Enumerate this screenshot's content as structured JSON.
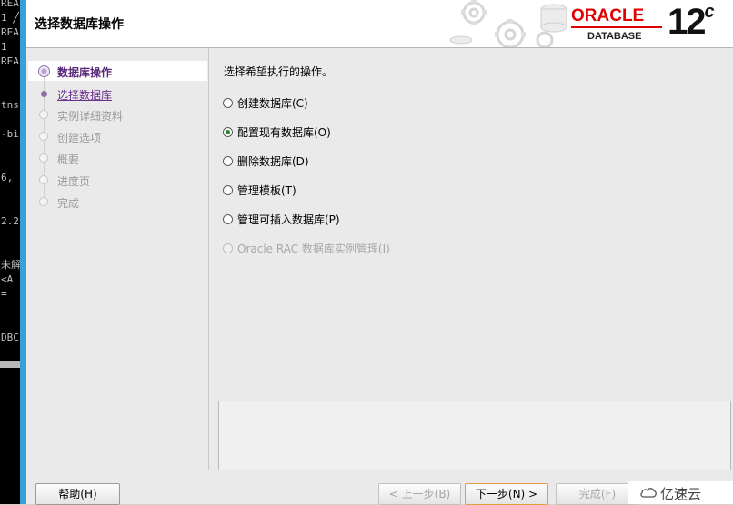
{
  "terminal": {
    "lines": [
      "REA",
      "1 ╱",
      "REA",
      "  1",
      "REA",
      "tns",
      "-bi",
      "6,",
      "2.2",
      "未解",
      " <A",
      " =",
      "DBC"
    ]
  },
  "window": {
    "title": "选择数据库操作"
  },
  "brand": {
    "oracle": "ORACLE",
    "database": "DATABASE",
    "version": "12",
    "version_suffix": "c",
    "colors": {
      "oracle_red": "#e00000"
    }
  },
  "nav": {
    "items": [
      {
        "label": "数据库操作",
        "state": "current"
      },
      {
        "label": "选择数据库",
        "state": "link"
      },
      {
        "label": "实例详细资料",
        "state": "disabled"
      },
      {
        "label": "创建选项",
        "state": "disabled"
      },
      {
        "label": "概要",
        "state": "disabled"
      },
      {
        "label": "进度页",
        "state": "disabled"
      },
      {
        "label": "完成",
        "state": "disabled"
      }
    ]
  },
  "content": {
    "prompt": "选择希望执行的操作。",
    "options": [
      {
        "label": "创建数据库(C)",
        "selected": false,
        "enabled": true
      },
      {
        "label": "配置现有数据库(O)",
        "selected": true,
        "enabled": true
      },
      {
        "label": "删除数据库(D)",
        "selected": false,
        "enabled": true
      },
      {
        "label": "管理模板(T)",
        "selected": false,
        "enabled": true
      },
      {
        "label": "管理可插入数据库(P)",
        "selected": false,
        "enabled": true
      },
      {
        "label": "Oracle RAC 数据库实例管理(I)",
        "selected": false,
        "enabled": false
      }
    ]
  },
  "footer": {
    "help": "帮助(H)",
    "back": "< 上一步(B)",
    "next": "下一步(N) >",
    "finish": "完成(F)"
  },
  "watermark": {
    "text": "亿速云"
  }
}
